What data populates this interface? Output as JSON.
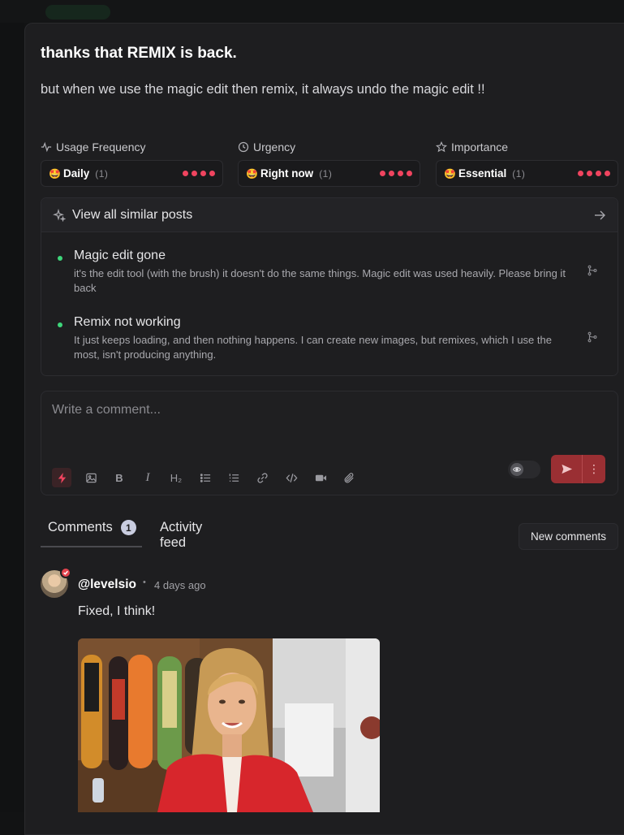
{
  "post": {
    "title": "thanks that REMIX is back.",
    "body": "but when we use the magic edit then remix, it always undo the magic edit !!"
  },
  "meta": [
    {
      "label": "Usage Frequency",
      "icon": "activity-icon",
      "emoji": "🤩",
      "value": "Daily",
      "count": "(1)",
      "dots": 4
    },
    {
      "label": "Urgency",
      "icon": "clock-icon",
      "emoji": "🤩",
      "value": "Right now",
      "count": "(1)",
      "dots": 4
    },
    {
      "label": "Importance",
      "icon": "star-icon",
      "emoji": "🤩",
      "value": "Essential",
      "count": "(1)",
      "dots": 4
    }
  ],
  "similar": {
    "header": "View all similar posts",
    "items": [
      {
        "title": "Magic edit gone",
        "desc": "it's the edit tool (with the brush) it doesn't do the same things. Magic edit was used heavily. Please bring it back"
      },
      {
        "title": "Remix not working",
        "desc": "It just keeps loading, and then nothing happens. I can create new images, but remixes, which I use the most, isn't producing anything."
      }
    ]
  },
  "composer": {
    "placeholder": "Write a comment...",
    "tools": [
      "lightning-icon",
      "image-icon",
      "bold-icon",
      "italic-icon",
      "heading-icon",
      "bullet-list-icon",
      "numbered-list-icon",
      "link-icon",
      "code-icon",
      "video-icon",
      "attachment-icon"
    ],
    "bold_label": "B",
    "italic_label": "I",
    "heading_label": "H₂",
    "more_label": "⋮"
  },
  "tabs": {
    "comments_label": "Comments",
    "comments_count": "1",
    "activity_label": "Activity feed",
    "new_comments_label": "New comments"
  },
  "comment": {
    "author": "@levelsio",
    "separator": "•",
    "time": "4 days ago",
    "text": "Fixed, I think!"
  },
  "colors": {
    "accent_red": "#f0445f",
    "send_red": "#9a2f33",
    "status_green": "#3ed67a",
    "panel_bg": "#1e1e20"
  }
}
